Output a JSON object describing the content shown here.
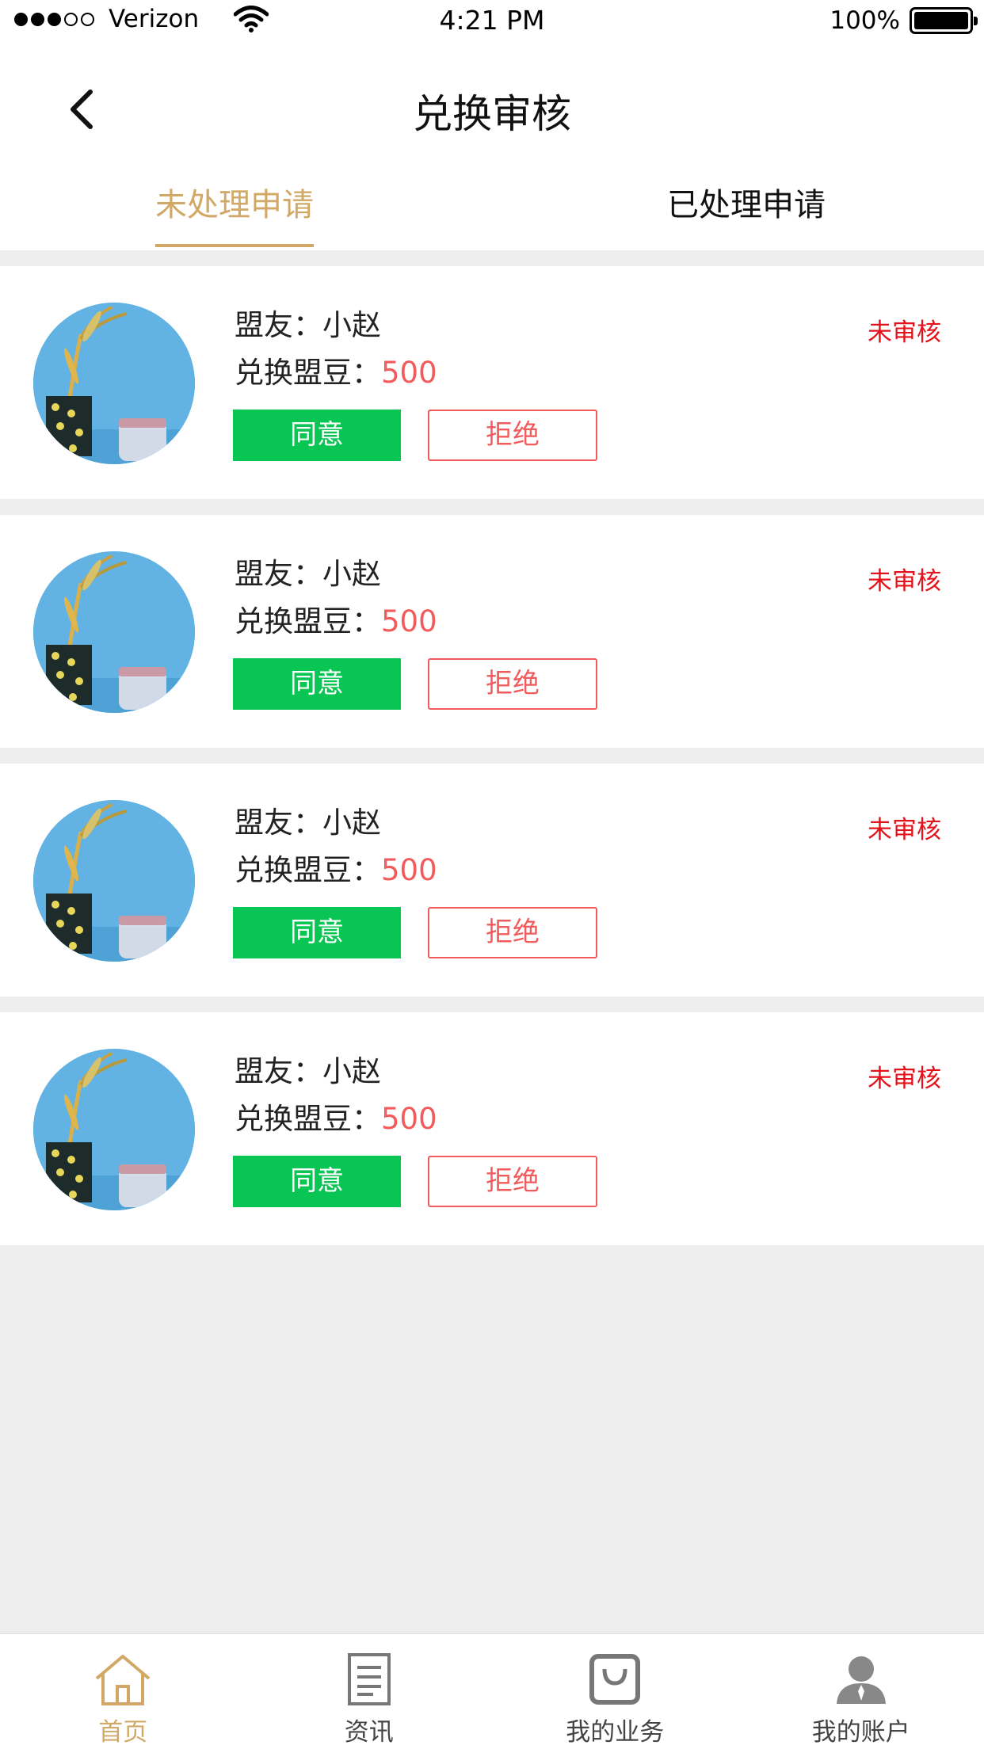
{
  "status_bar": {
    "carrier": "Verizon",
    "time": "4:21 PM",
    "battery": "100%"
  },
  "header": {
    "title": "兑换审核"
  },
  "tabs": [
    {
      "label": "未处理申请",
      "active": true
    },
    {
      "label": "已处理申请",
      "active": false
    }
  ],
  "colors": {
    "accent": "#d2a866",
    "agree": "#09c654",
    "reject": "#f25b5b",
    "status_red": "#e3131b"
  },
  "requests": [
    {
      "friend_label": "盟友：小赵",
      "beans_label": "兑换盟豆：",
      "beans_amount": "500",
      "status": "未审核",
      "agree_label": "同意",
      "reject_label": "拒绝"
    },
    {
      "friend_label": "盟友：小赵",
      "beans_label": "兑换盟豆：",
      "beans_amount": "500",
      "status": "未审核",
      "agree_label": "同意",
      "reject_label": "拒绝"
    },
    {
      "friend_label": "盟友：小赵",
      "beans_label": "兑换盟豆：",
      "beans_amount": "500",
      "status": "未审核",
      "agree_label": "同意",
      "reject_label": "拒绝"
    },
    {
      "friend_label": "盟友：小赵",
      "beans_label": "兑换盟豆：",
      "beans_amount": "500",
      "status": "未审核",
      "agree_label": "同意",
      "reject_label": "拒绝"
    }
  ],
  "tab_bar": [
    {
      "label": "首页",
      "icon": "home-icon",
      "active": true
    },
    {
      "label": "资讯",
      "icon": "news-icon",
      "active": false
    },
    {
      "label": "我的业务",
      "icon": "business-icon",
      "active": false
    },
    {
      "label": "我的账户",
      "icon": "account-icon",
      "active": false
    }
  ]
}
